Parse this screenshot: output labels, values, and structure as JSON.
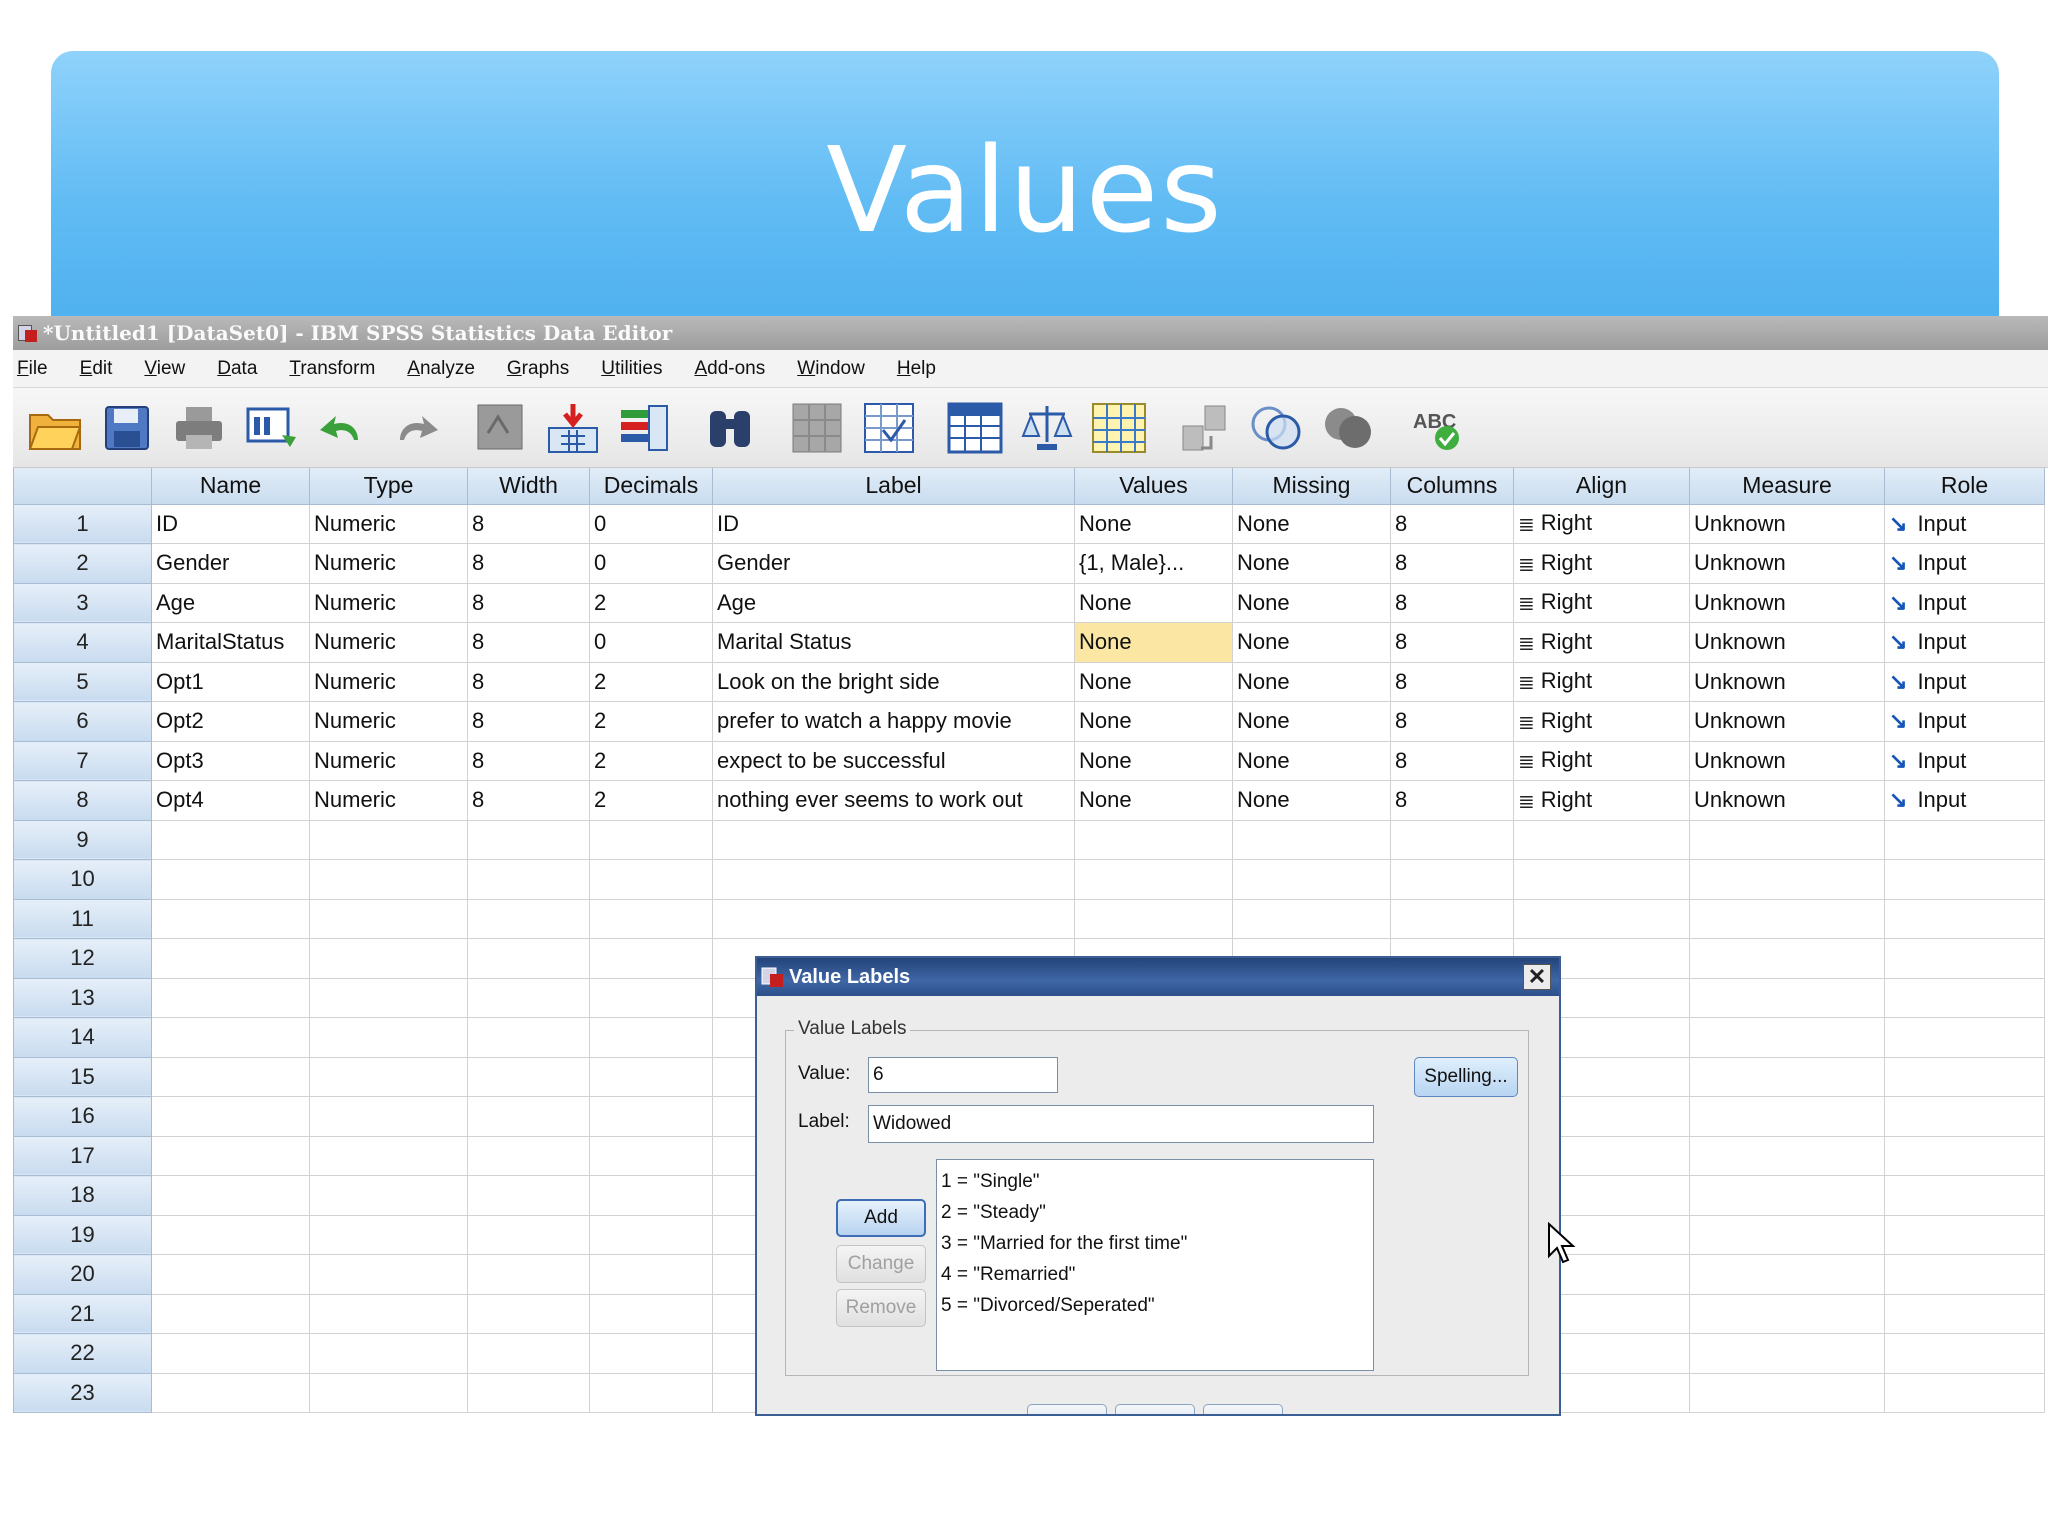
{
  "slide": {
    "title": "Values"
  },
  "window": {
    "title": "*Untitled1 [DataSet0] - IBM SPSS Statistics Data Editor"
  },
  "menu": [
    "File",
    "Edit",
    "View",
    "Data",
    "Transform",
    "Analyze",
    "Graphs",
    "Utilities",
    "Add-ons",
    "Window",
    "Help"
  ],
  "toolbar_icons": [
    "open-folder-icon",
    "save-disk-icon",
    "print-icon",
    "recall-dialog-icon",
    "undo-icon",
    "redo-icon",
    "goto-case-icon",
    "insert-variable-icon",
    "variables-icon",
    "find-binoculars-icon",
    "insert-cases-icon",
    "split-file-icon",
    "select-cases-icon",
    "weight-cases-icon",
    "value-labels-icon",
    "use-sets-icon",
    "show-sets-icon",
    "venn-icon",
    "circles-icon",
    "spell-check-icon"
  ],
  "grid": {
    "columns": [
      "Name",
      "Type",
      "Width",
      "Decimals",
      "Label",
      "Values",
      "Missing",
      "Columns",
      "Align",
      "Measure",
      "Role"
    ],
    "rows": [
      [
        "1",
        "ID",
        "Numeric",
        "8",
        "0",
        "ID",
        "None",
        "None",
        "8",
        "Right",
        "Unknown",
        "Input"
      ],
      [
        "2",
        "Gender",
        "Numeric",
        "8",
        "0",
        "Gender",
        "{1, Male}...",
        "None",
        "8",
        "Right",
        "Unknown",
        "Input"
      ],
      [
        "3",
        "Age",
        "Numeric",
        "8",
        "2",
        "Age",
        "None",
        "None",
        "8",
        "Right",
        "Unknown",
        "Input"
      ],
      [
        "4",
        "MaritalStatus",
        "Numeric",
        "8",
        "0",
        "Marital Status",
        "None",
        "None",
        "8",
        "Right",
        "Unknown",
        "Input"
      ],
      [
        "5",
        "Opt1",
        "Numeric",
        "8",
        "2",
        "Look on the bright side",
        "None",
        "None",
        "8",
        "Right",
        "Unknown",
        "Input"
      ],
      [
        "6",
        "Opt2",
        "Numeric",
        "8",
        "2",
        "prefer to watch a happy movie",
        "None",
        "None",
        "8",
        "Right",
        "Unknown",
        "Input"
      ],
      [
        "7",
        "Opt3",
        "Numeric",
        "8",
        "2",
        "expect to be successful",
        "None",
        "None",
        "8",
        "Right",
        "Unknown",
        "Input"
      ],
      [
        "8",
        "Opt4",
        "Numeric",
        "8",
        "2",
        "nothing ever seems to work out",
        "None",
        "None",
        "8",
        "Right",
        "Unknown",
        "Input"
      ]
    ],
    "empty_rows": [
      "9",
      "10",
      "11",
      "12",
      "13",
      "14",
      "15",
      "16",
      "17",
      "18",
      "19",
      "20",
      "21",
      "22",
      "23"
    ],
    "highlighted_cell": {
      "row": 4,
      "column": "Values"
    }
  },
  "dialog": {
    "title": "Value Labels",
    "group_label": "Value Labels",
    "value_label": "Value:",
    "value": "6",
    "label_label": "Label:",
    "label": "Widowed",
    "spelling_button": "Spelling...",
    "add_button": "Add",
    "change_button": "Change",
    "remove_button": "Remove",
    "list": [
      "1 = \"Single\"",
      "2 = \"Steady\"",
      "3 = \"Married for the first time\"",
      "4 = \"Remarried\"",
      "5 = \"Divorced/Seperated\""
    ]
  },
  "colors": {
    "banner": "#62bcf4",
    "highlight_cell": "#fbe7a3",
    "dialog_title": "#2c4f8a",
    "role_icon": "#1555b8"
  }
}
